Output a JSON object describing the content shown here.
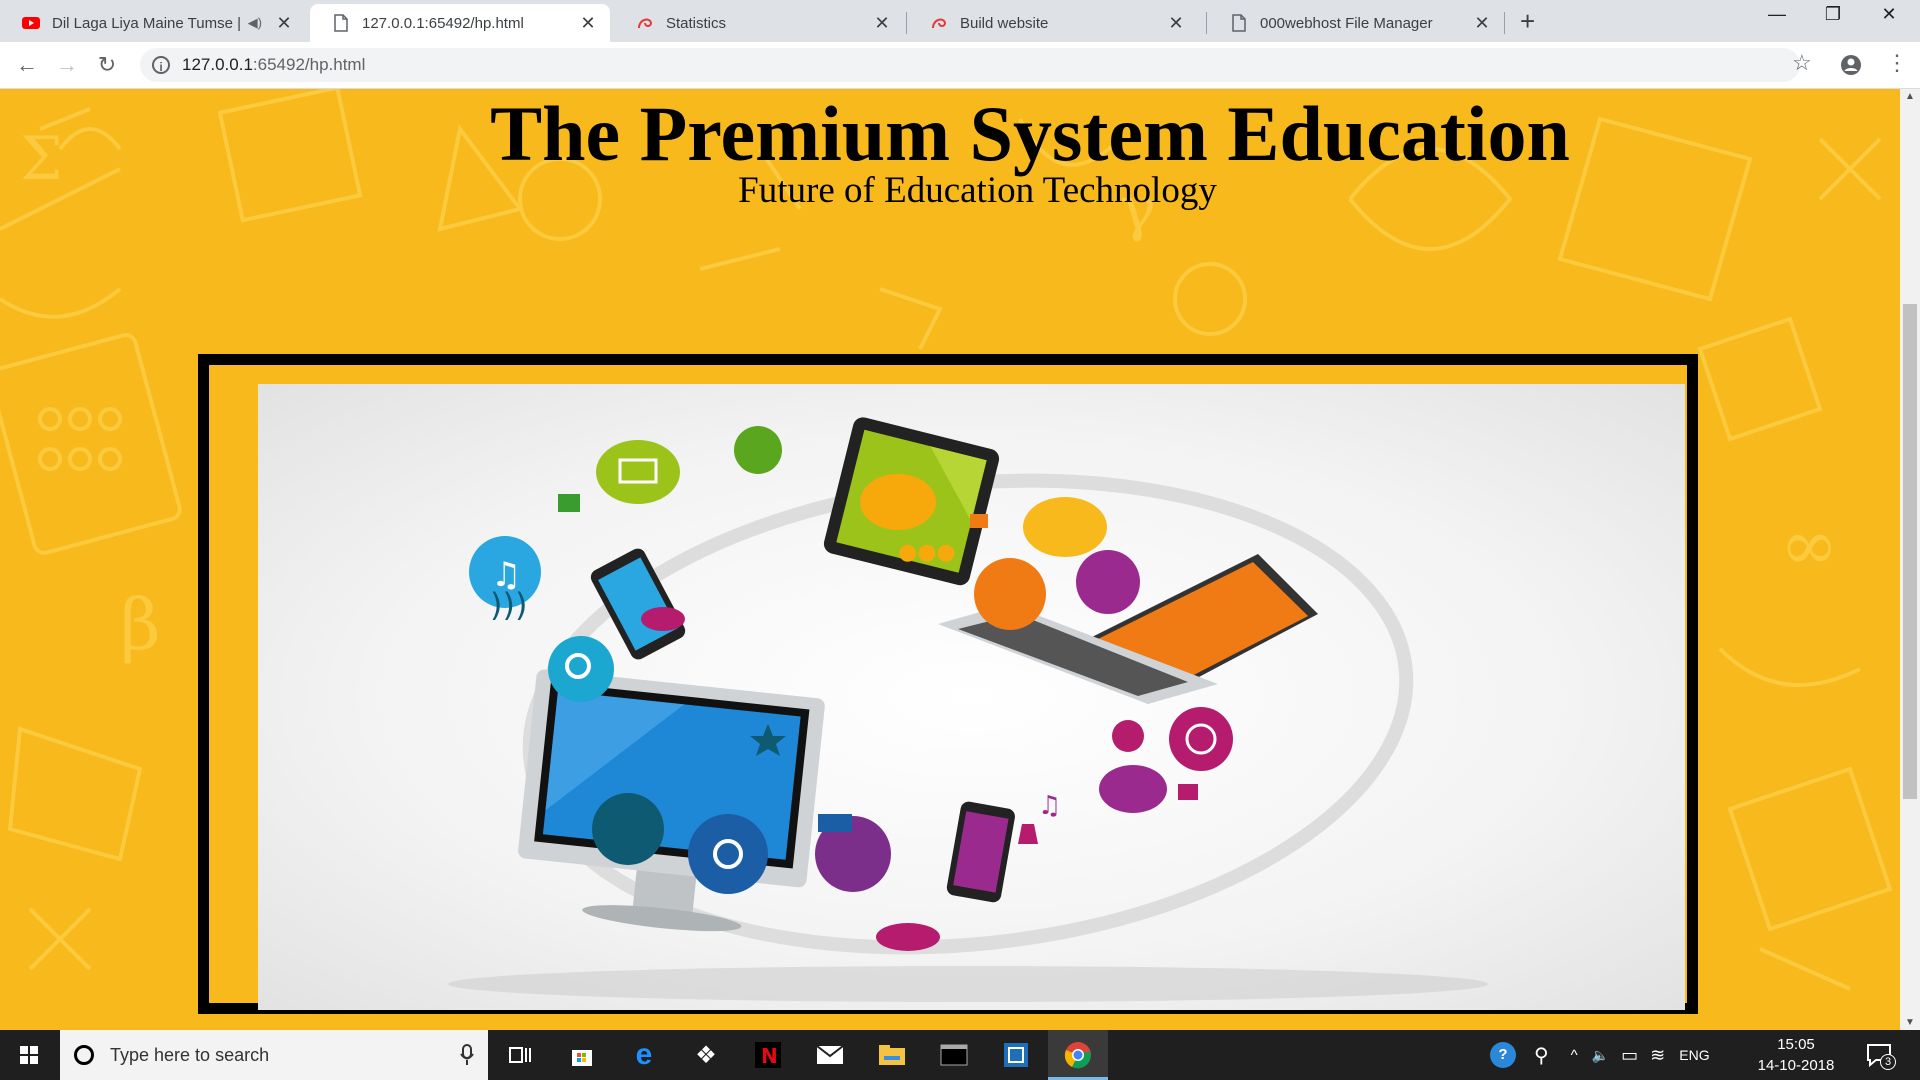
{
  "browser": {
    "tabs": [
      {
        "title": "Dil Laga Liya Maine Tumse | ",
        "icon": "youtube-icon",
        "extra": "speaker-muted-icon",
        "active": false
      },
      {
        "title": "127.0.0.1:65492/hp.html",
        "icon": "page-icon",
        "active": true
      },
      {
        "title": "Statistics",
        "icon": "swirl-icon",
        "active": false
      },
      {
        "title": "Build website",
        "icon": "swirl-icon",
        "active": false
      },
      {
        "title": "000webhost File Manager",
        "icon": "page-icon",
        "active": false
      }
    ],
    "close_glyph": "✕",
    "new_tab_glyph": "+",
    "window_controls": {
      "minimize": "—",
      "restore": "❐",
      "close": "✕"
    },
    "nav": {
      "back": "←",
      "forward": "→",
      "reload": "↻"
    },
    "address": {
      "host": "127.0.0.1",
      "path": ":65492/hp.html",
      "info_glyph": "i"
    },
    "toolbar_right": {
      "star": "☆",
      "account": "●",
      "menu": "⋮"
    }
  },
  "page": {
    "title": "The Premium System Education",
    "subtitle": "Future of Education Technology",
    "image_subject": "devices-cloud-illustration"
  },
  "taskbar": {
    "search_placeholder": "Type here to search",
    "apps": [
      "task-view-icon",
      "store-icon",
      "edge-icon",
      "dropbox-icon",
      "netflix-icon",
      "mail-icon",
      "file-explorer-icon",
      "terminal-icon",
      "snip-icon",
      "chrome-icon"
    ],
    "tray": {
      "help": "?",
      "people": "⚲",
      "chevron": "^",
      "volume": "🔈",
      "battery": "▭",
      "wifi": "≋",
      "lang": "ENG"
    },
    "time": "15:05",
    "date": "14-10-2018",
    "notifications": "3"
  },
  "colors": {
    "page_bg": "#f7b91c",
    "frame": "#000000",
    "taskbar": "#1f1f1f",
    "tab_strip": "#dee1e6"
  }
}
